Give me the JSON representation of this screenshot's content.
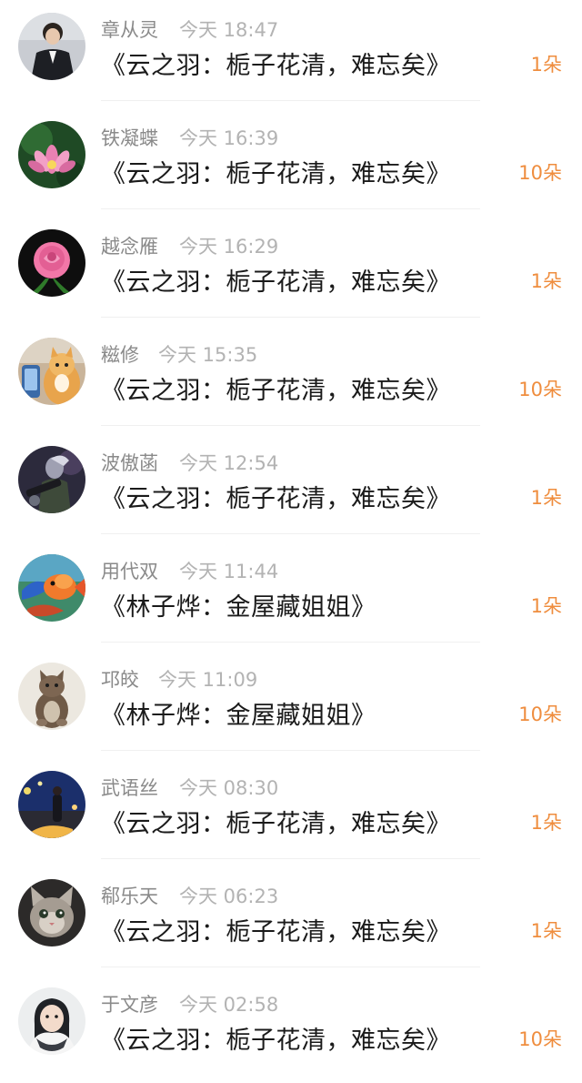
{
  "rows": [
    {
      "name": "章从灵",
      "time": "今天 18:47",
      "gift": "《云之羽：栀子花清，难忘矣》",
      "count": "1朵",
      "avatar": "man-in-suit-avatar",
      "avatar_colors": {
        "bg": "#c9ccd2",
        "fg": "#1d1f24"
      }
    },
    {
      "name": "铁凝蝶",
      "time": "今天 16:39",
      "gift": "《云之羽：栀子花清，难忘矣》",
      "count": "10朵",
      "avatar": "lotus-flower-avatar",
      "avatar_colors": {
        "bg": "#1f4a25",
        "fg": "#e981b2"
      }
    },
    {
      "name": "越念雁",
      "time": "今天 16:29",
      "gift": "《云之羽：栀子花清，难忘矣》",
      "count": "1朵",
      "avatar": "pink-rose-avatar",
      "avatar_colors": {
        "bg": "#0e0e0e",
        "fg": "#f277a8"
      }
    },
    {
      "name": "糍修",
      "time": "今天 15:35",
      "gift": "《云之羽：栀子花清，难忘矣》",
      "count": "10朵",
      "avatar": "cat-with-phone-avatar",
      "avatar_colors": {
        "bg": "#c9b49a",
        "fg": "#e8a44c"
      }
    },
    {
      "name": "波傲菡",
      "time": "今天 12:54",
      "gift": "《云之羽：栀子花清，难忘矣》",
      "count": "1朵",
      "avatar": "game-character-avatar",
      "avatar_colors": {
        "bg": "#2c2a3c",
        "fg": "#9fa0b2"
      }
    },
    {
      "name": "用代双",
      "time": "今天 11:44",
      "gift": "《林子烨：金屋藏姐姐》",
      "count": "1朵",
      "avatar": "goldfish-avatar",
      "avatar_colors": {
        "bg": "#3f8a6a",
        "fg": "#f17a2c"
      }
    },
    {
      "name": "邛皎",
      "time": "今天 11:09",
      "gift": "《林子烨：金屋藏姐姐》",
      "count": "10朵",
      "avatar": "sitting-cat-avatar",
      "avatar_colors": {
        "bg": "#ece8e0",
        "fg": "#6f5a47"
      }
    },
    {
      "name": "武语丝",
      "time": "今天 08:30",
      "gift": "《云之羽：栀子花清，难忘矣》",
      "count": "1朵",
      "avatar": "night-street-avatar",
      "avatar_colors": {
        "bg": "#1b2f6b",
        "fg": "#f0b548"
      }
    },
    {
      "name": "郗乐天",
      "time": "今天 06:23",
      "gift": "《云之羽：栀子花清，难忘矣》",
      "count": "1朵",
      "avatar": "kitten-face-avatar",
      "avatar_colors": {
        "bg": "#2c2a29",
        "fg": "#b9b1a7"
      }
    },
    {
      "name": "于文彦",
      "time": "今天 02:58",
      "gift": "《云之羽：栀子花清，难忘矣》",
      "count": "10朵",
      "avatar": "woman-scarf-avatar",
      "avatar_colors": {
        "bg": "#eceeef",
        "fg": "#202226"
      }
    }
  ]
}
